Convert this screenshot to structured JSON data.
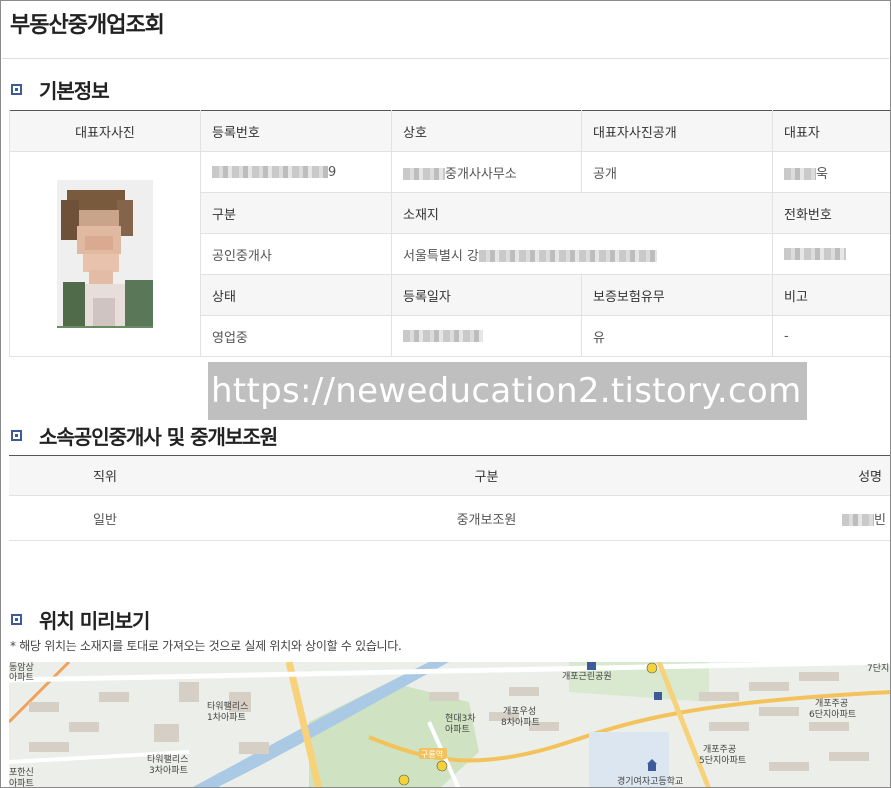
{
  "page": {
    "title": "부동산중개업조회"
  },
  "basic": {
    "section_title": "기본정보",
    "headers": {
      "photo": "대표자사진",
      "reg_no": "등록번호",
      "name": "상호",
      "photo_public": "대표자사진공개",
      "rep": "대표자",
      "type": "구분",
      "address": "소재지",
      "phone": "전화번호",
      "status": "상태",
      "reg_date": "등록일자",
      "insurance": "보증보험유무",
      "remark": "비고"
    },
    "values": {
      "reg_no_suffix": "9",
      "name_suffix": "중개사사무소",
      "photo_public": "공개",
      "rep_suffix": "욱",
      "type": "공인중개사",
      "address_prefix": "서울특별시 강",
      "status": "영업중",
      "insurance": "유",
      "remark": "-"
    }
  },
  "watermark": "https://neweducation2.tistory.com",
  "staff": {
    "section_title": "소속공인중개사 및 중개보조원",
    "headers": {
      "position": "직위",
      "type": "구분",
      "name": "성명"
    },
    "rows": [
      {
        "position": "일반",
        "type": "중개보조원",
        "name_suffix": "빈"
      }
    ]
  },
  "location": {
    "section_title": "위치 미리보기",
    "note": "* 해당 위치는 소재지를 토대로 가져오는 것으로 실제 위치와 상이할 수 있습니다.",
    "map_labels": {
      "l1": "동암상",
      "l2": "아파트",
      "l3": "타워팰리스",
      "l4": "1차아파트",
      "l5": "타워팰리스",
      "l6": "3차아파트",
      "l7": "포한신",
      "l8": "아파트",
      "l9": "현대3차",
      "l10": "아파트",
      "l11": "개포우성",
      "l12": "8차아파트",
      "l13": "개포근린공원",
      "l14": "개포주공",
      "l15": "5단지아파트",
      "l16": "개포주공",
      "l17": "6단지아파트",
      "l18": "7단지",
      "l19": "경기여자고등학교",
      "l20": "구룡역"
    }
  }
}
